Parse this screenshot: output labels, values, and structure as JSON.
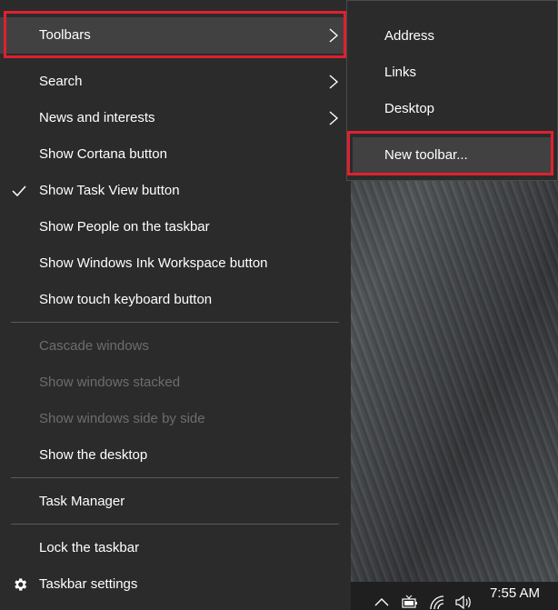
{
  "context_menu": {
    "items": [
      {
        "label": "Toolbars",
        "has_submenu": true
      },
      {
        "label": "Search",
        "has_submenu": true
      },
      {
        "label": "News and interests",
        "has_submenu": true
      },
      {
        "label": "Show Cortana button"
      },
      {
        "label": "Show Task View button",
        "checked": true
      },
      {
        "label": "Show People on the taskbar"
      },
      {
        "label": "Show Windows Ink Workspace button"
      },
      {
        "label": "Show touch keyboard button"
      },
      {
        "label": "Cascade windows",
        "disabled": true
      },
      {
        "label": "Show windows stacked",
        "disabled": true
      },
      {
        "label": "Show windows side by side",
        "disabled": true
      },
      {
        "label": "Show the desktop"
      },
      {
        "label": "Task Manager"
      },
      {
        "label": "Lock the taskbar"
      },
      {
        "label": "Taskbar settings",
        "icon": "gear-icon"
      }
    ]
  },
  "toolbars_submenu": {
    "items": [
      {
        "label": "Address"
      },
      {
        "label": "Links"
      },
      {
        "label": "Desktop"
      },
      {
        "label": "New toolbar..."
      }
    ]
  },
  "taskbar": {
    "clock": "7:55 AM",
    "tray_icons": [
      "chevron-up-icon",
      "battery-icon",
      "wifi-icon",
      "volume-icon"
    ]
  },
  "colors": {
    "menu_bg": "#2b2b2b",
    "hover_bg": "#414141",
    "highlight_red": "#e0202f",
    "disabled_text": "#6d6d6d"
  }
}
